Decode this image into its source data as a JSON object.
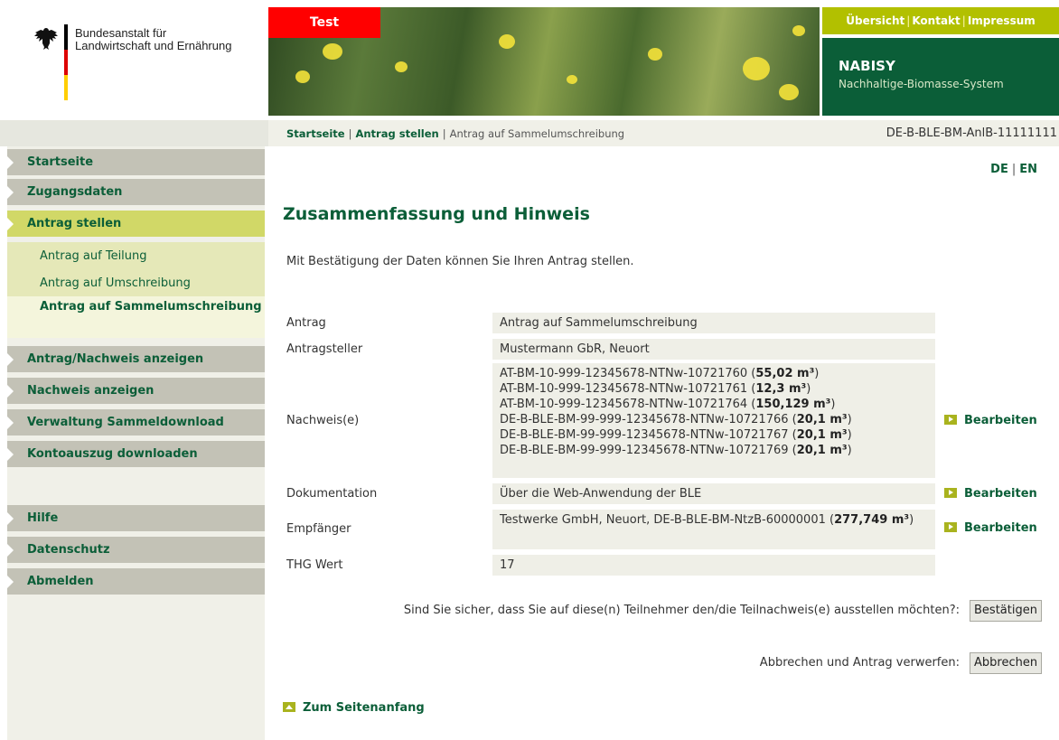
{
  "header": {
    "org_line1": "Bundesanstalt für",
    "org_line2": "Landwirtschaft und Ernährung",
    "test_badge": "Test",
    "top_links": [
      "Übersicht",
      "Kontakt",
      "Impressum"
    ],
    "brand_title": "NABISY",
    "brand_subtitle": "Nachhaltige-Biomasse-System",
    "icons": {
      "logo": "eagle-icon"
    }
  },
  "breadcrumb": {
    "items": [
      "Startseite",
      "Antrag stellen",
      "Antrag auf Sammelumschreibung"
    ],
    "separator": "|"
  },
  "account_id": "DE-B-BLE-BM-AnlB-11111111",
  "language": {
    "de": "DE",
    "en": "EN",
    "separator": "|"
  },
  "sidebar": {
    "items": [
      {
        "label": "Startseite"
      },
      {
        "label": "Zugangsdaten"
      },
      {
        "label": "Antrag stellen"
      },
      {
        "label": "Antrag/Nachweis anzeigen"
      },
      {
        "label": "Nachweis anzeigen"
      },
      {
        "label": "Verwaltung Sammeldownload"
      },
      {
        "label": "Kontoauszug downloaden"
      },
      {
        "label": "Hilfe"
      },
      {
        "label": "Datenschutz"
      },
      {
        "label": "Abmelden"
      }
    ],
    "subitems": [
      {
        "label": "Antrag auf Teilung"
      },
      {
        "label": "Antrag auf Umschreibung"
      },
      {
        "label": "Antrag auf Sammelumschreibung"
      }
    ]
  },
  "main": {
    "title": "Zusammenfassung und Hinweis",
    "intro": "Mit Bestätigung der Daten können Sie Ihren Antrag stellen.",
    "rows": {
      "antrag": {
        "label": "Antrag",
        "value": "Antrag auf Sammelumschreibung"
      },
      "antragsteller": {
        "label": "Antragsteller",
        "value": "Mustermann GbR, Neuort"
      },
      "nachweise": {
        "label": "Nachweis(e)",
        "entries": [
          {
            "id": "AT-BM-10-999-12345678-NTNw-10721760",
            "amount": "55,02 m³"
          },
          {
            "id": "AT-BM-10-999-12345678-NTNw-10721761",
            "amount": "12,3 m³"
          },
          {
            "id": "AT-BM-10-999-12345678-NTNw-10721764",
            "amount": "150,129 m³"
          },
          {
            "id": "DE-B-BLE-BM-99-999-12345678-NTNw-10721766",
            "amount": "20,1 m³"
          },
          {
            "id": "DE-B-BLE-BM-99-999-12345678-NTNw-10721767",
            "amount": "20,1 m³"
          },
          {
            "id": "DE-B-BLE-BM-99-999-12345678-NTNw-10721769",
            "amount": "20,1 m³"
          }
        ]
      },
      "dokumentation": {
        "label": "Dokumentation",
        "value": "Über die Web-Anwendung der BLE"
      },
      "empfaenger": {
        "label": "Empfänger",
        "value": "Testwerke GmbH, Neuort, DE-B-BLE-BM-NtzB-60000001",
        "amount": "277,749 m³"
      },
      "thg": {
        "label": "THG Wert",
        "value": "17"
      }
    },
    "edit_label": "Bearbeiten",
    "confirm_question": "Sind Sie sicher, dass Sie auf diese(n) Teilnehmer den/die Teilnachweis(e) ausstellen möchten?:",
    "confirm_button": "Bestätigen",
    "cancel_question": "Abbrechen und Antrag verwerfen:",
    "cancel_button": "Abbrechen",
    "to_top": "Zum Seitenanfang"
  },
  "colors": {
    "primary_green": "#0b5e38",
    "accent_lime": "#b2c000",
    "nav_gray": "#c3c2b6",
    "nav_active": "#d1d867",
    "test_red": "#ff0000"
  }
}
